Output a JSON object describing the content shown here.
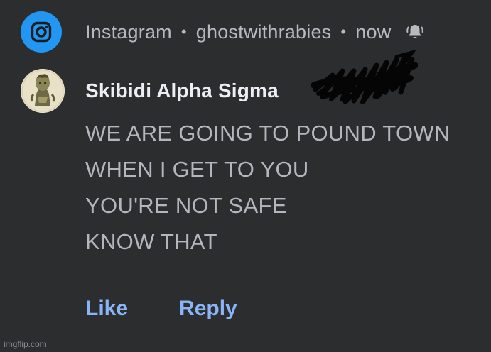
{
  "notification": {
    "app_name": "Instagram",
    "separator": "•",
    "account": "ghostwithrabies",
    "time": "now",
    "app_icon": "instagram-icon",
    "bell_icon": "bell-ringing-icon",
    "sender_name": "Skibidi Alpha Sigma",
    "message_lines": [
      "WE ARE GOING TO POUND TOWN",
      "WHEN I GET TO YOU",
      "YOU'RE NOT SAFE",
      "KNOW THAT"
    ],
    "actions": {
      "like_label": "Like",
      "reply_label": "Reply"
    }
  },
  "watermark": "imgflip.com",
  "colors": {
    "background": "#2c2d2f",
    "app_icon_bg": "#2196f3",
    "action_text": "#8ab4f8",
    "header_text": "#b7b9bc",
    "sender_text": "#eceff1",
    "message_text": "#b4b6b9"
  }
}
